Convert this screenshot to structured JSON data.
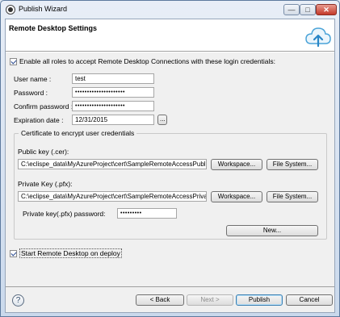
{
  "window": {
    "title": "Publish Wizard",
    "minimize_glyph": "—",
    "maximize_glyph": "□",
    "close_glyph": "✕"
  },
  "banner": {
    "title": "Remote Desktop Settings",
    "icon": "cloud-upload-icon"
  },
  "enable_roles": {
    "checked": true,
    "label": "Enable all roles to accept Remote Desktop Connections with these login credentials:"
  },
  "credentials": {
    "username_label": "User name :",
    "username_value": "test",
    "password_label": "Password :",
    "password_value": "•••••••••••••••••••••",
    "confirm_label": "Confirm password :",
    "confirm_value": "•••••••••••••••••••••",
    "expiration_label": "Expiration date :",
    "expiration_value": "12/31/2015",
    "date_picker_label": "..."
  },
  "certificate": {
    "group_title": "Certificate to encrypt user credentials",
    "public_key_label": "Public key (.cer):",
    "public_key_value": "C:\\eclispe_data\\MyAzureProject\\cert\\SampleRemoteAccessPublic.c",
    "private_key_label": "Private Key (.pfx):",
    "private_key_value": "C:\\eclipse_data\\MyAzureProject\\cert\\SampleRemoteAccessPrivate.",
    "private_pw_label": "Private key(.pfx) password:",
    "private_pw_value": "•••••••••",
    "workspace_label": "Workspace...",
    "file_system_label": "File System...",
    "new_label": "New..."
  },
  "start_rdp": {
    "checked": true,
    "label": "Start Remote Desktop on deploy"
  },
  "footer": {
    "help_glyph": "?",
    "back_label": "< Back",
    "next_label": "Next >",
    "publish_label": "Publish",
    "cancel_label": "Cancel"
  }
}
